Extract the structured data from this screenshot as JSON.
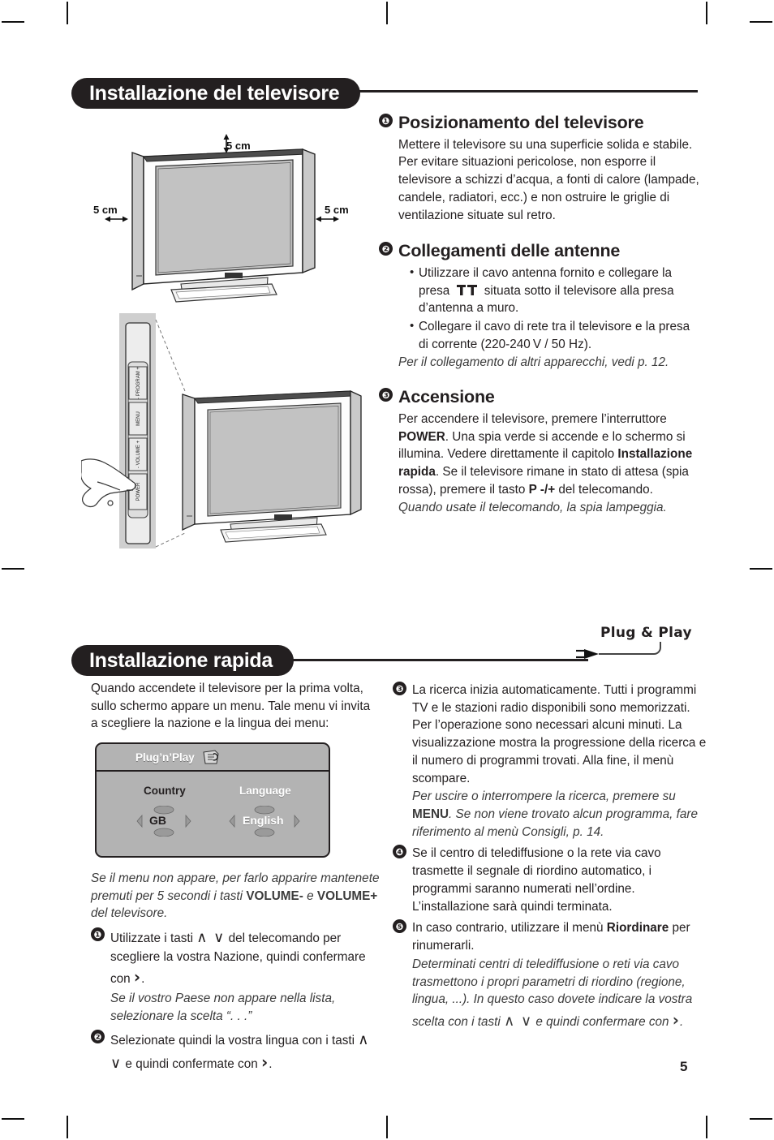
{
  "page": {
    "number": "5"
  },
  "section1": {
    "banner_title": "Installazione del televisore",
    "diagram": {
      "dim_top": "5 cm",
      "dim_left": "5 cm",
      "dim_right": "5 cm",
      "side_buttons": [
        "- PROGRAM +",
        "MENU",
        "- VOLUME +",
        "POWER"
      ]
    },
    "items": [
      {
        "number": "❶",
        "heading": "Posizionamento del televisore",
        "body": "Mettere il televisore su una superficie solida e stabile. Per evitare situazioni pericolose, non esporre il televisore a schizzi d’acqua, a fonti di calore (lampade, candele, radiatori, ecc.) e non ostruire le griglie di ventilazione situate sul retro."
      },
      {
        "number": "❷",
        "heading": "Collegamenti delle antenne",
        "bullet1_a": "Utilizzare il cavo antenna fornito e collegare la presa",
        "bullet1_b": "situata sotto il televisore alla presa d’antenna a muro.",
        "bullet2": "Collegare il cavo di rete tra il televisore e la presa di corrente (220-240 V / 50 Hz).",
        "note": "Per il collegamento di altri apparecchi, vedi p. 12."
      },
      {
        "number": "❸",
        "heading": "Accensione",
        "p1": "Per accendere il televisore, premere l’interruttore ",
        "bold1": "POWER",
        "p2": ". Una spia verde si accende e lo schermo si illumina. Vedere direttamente il capitolo ",
        "bold2": "Installazione rapida",
        "p3": ". Se il televisore rimane in stato di attesa (spia rossa), premere il tasto ",
        "bold3": "P -/+",
        "p4": " del telecomando.",
        "note": "Quando usate il telecomando, la spia lampeggia."
      }
    ]
  },
  "section2": {
    "banner_title": "Installazione rapida",
    "logo_text": "Plug & Play",
    "intro": "Quando accendete il televisore per la prima volta, sullo schermo appare un menu. Tale menu vi invita a scegliere la nazione e la lingua dei menu:",
    "osd": {
      "title": "Plug’n’Play",
      "country_label": "Country",
      "country_value": "GB",
      "language_label": "Language",
      "language_value": "English"
    },
    "note_after_osd_a": "Se il menu non appare, per farlo apparire mantenete premuti per 5 secondi i tasti ",
    "note_after_osd_b": "VOLUME-",
    "note_after_osd_c": " e ",
    "note_after_osd_d": "VOLUME+",
    "note_after_osd_e": " del televisore.",
    "left_items": [
      {
        "number": "❶",
        "p1": "Utilizzate i tasti ",
        "keys": "∧ ∨",
        "p2": " del telecomando per scegliere la vostra Nazione, quindi confermare con ",
        "key2": "›",
        "p3": ".",
        "note": "Se il vostro Paese non appare nella lista, selezionare la scelta “. . .”"
      },
      {
        "number": "❷",
        "p1": "Selezionate quindi la vostra lingua con i tasti ",
        "keys": "∧ ∨",
        "p2": " e quindi confermate con ",
        "key2": "›",
        "p3": "."
      }
    ],
    "right_items": [
      {
        "number": "❸",
        "body": "La ricerca inizia automaticamente. Tutti i programmi TV e le stazioni radio disponibili sono memorizzati. Per l’operazione sono necessari alcuni minuti. La visualizzazione mostra la progressione della ricerca e il numero di programmi trovati.  Alla fine, il menù scompare.",
        "note_a": "Per uscire o interrompere la ricerca, premere su ",
        "note_b": "MENU",
        "note_c": ". Se non viene trovato alcun programma, fare riferimento al menù Consigli, p. 14."
      },
      {
        "number": "❹",
        "body": "Se il centro di telediffusione o la rete via cavo trasmette il segnale di riordino automatico, i programmi saranno numerati nell’ordine. L’installazione sarà quindi terminata."
      },
      {
        "number": "❺",
        "p1": "In caso contrario, utilizzare il menù ",
        "bold1": "Riordinare",
        "p2": " per rinumerarli.",
        "note_a": "Determinati centri di telediffusione o reti via cavo trasmettono i propri parametri di riordino (regione, lingua, ...). In questo caso dovete indicare la vostra scelta con i tasti ",
        "note_keys": "∧ ∨",
        "note_b": " e quindi confermare con ",
        "note_key2": "›",
        "note_c": "."
      }
    ]
  }
}
